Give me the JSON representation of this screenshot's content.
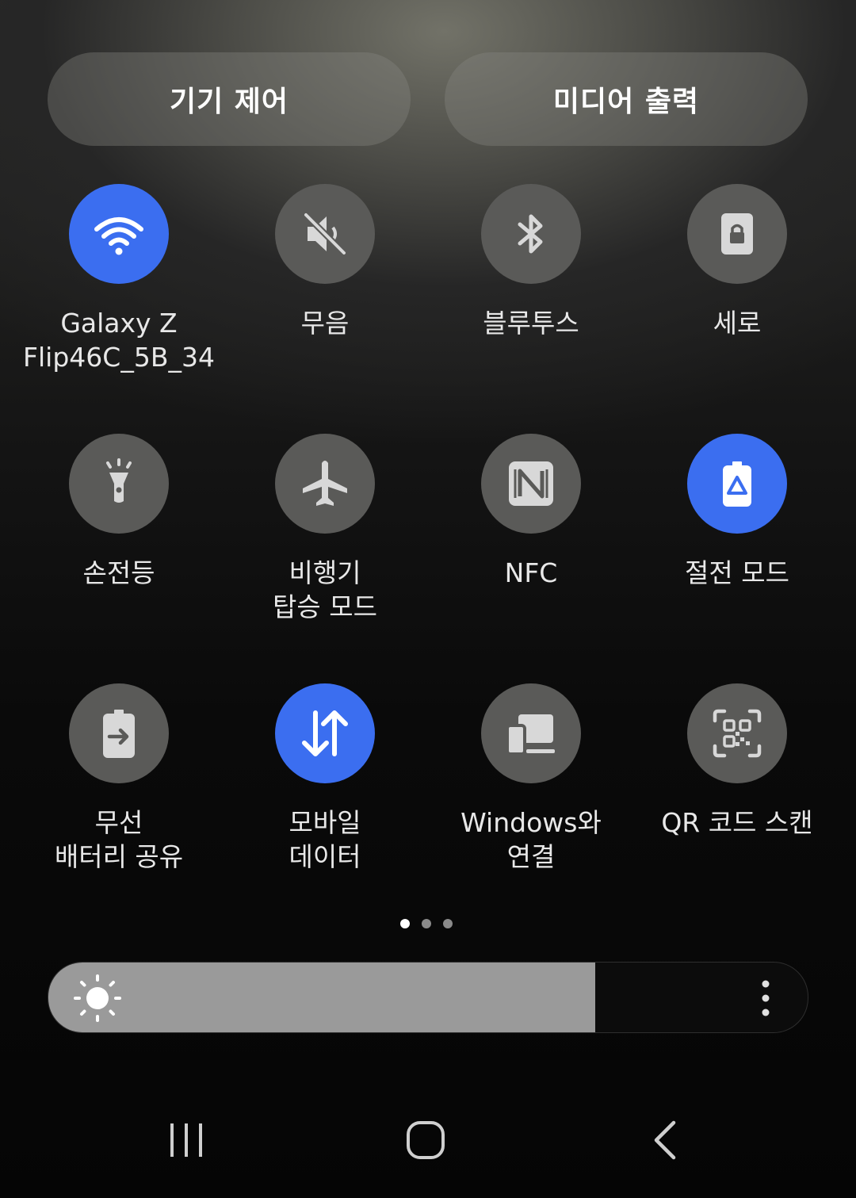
{
  "top_buttons": {
    "device_control": "기기 제어",
    "media_output": "미디어 출력"
  },
  "tiles": [
    {
      "label": "Galaxy Z\nFlip46C_5B_34",
      "icon": "wifi-icon",
      "active": true
    },
    {
      "label": "무음",
      "icon": "mute-icon",
      "active": false
    },
    {
      "label": "블루투스",
      "icon": "bluetooth-icon",
      "active": false
    },
    {
      "label": "세로",
      "icon": "portrait-lock-icon",
      "active": false
    },
    {
      "label": "손전등",
      "icon": "flashlight-icon",
      "active": false
    },
    {
      "label": "비행기\n탑승 모드",
      "icon": "airplane-icon",
      "active": false
    },
    {
      "label": "NFC",
      "icon": "nfc-icon",
      "active": false
    },
    {
      "label": "절전 모드",
      "icon": "power-saving-icon",
      "active": true
    },
    {
      "label": "무선\n배터리 공유",
      "icon": "wireless-battery-share-icon",
      "active": false
    },
    {
      "label": "모바일\n데이터",
      "icon": "mobile-data-icon",
      "active": true
    },
    {
      "label": "Windows와\n연결",
      "icon": "link-to-windows-icon",
      "active": false
    },
    {
      "label": "QR 코드 스캔",
      "icon": "qr-scan-icon",
      "active": false
    }
  ],
  "pagination": {
    "pages": 3,
    "current": 1
  },
  "brightness": {
    "level": 0.72
  },
  "colors": {
    "active_tile": "#3b6ef0",
    "inactive_tile": "#5a5a58"
  },
  "navigation": [
    "recent-apps-icon",
    "home-icon",
    "back-icon"
  ]
}
